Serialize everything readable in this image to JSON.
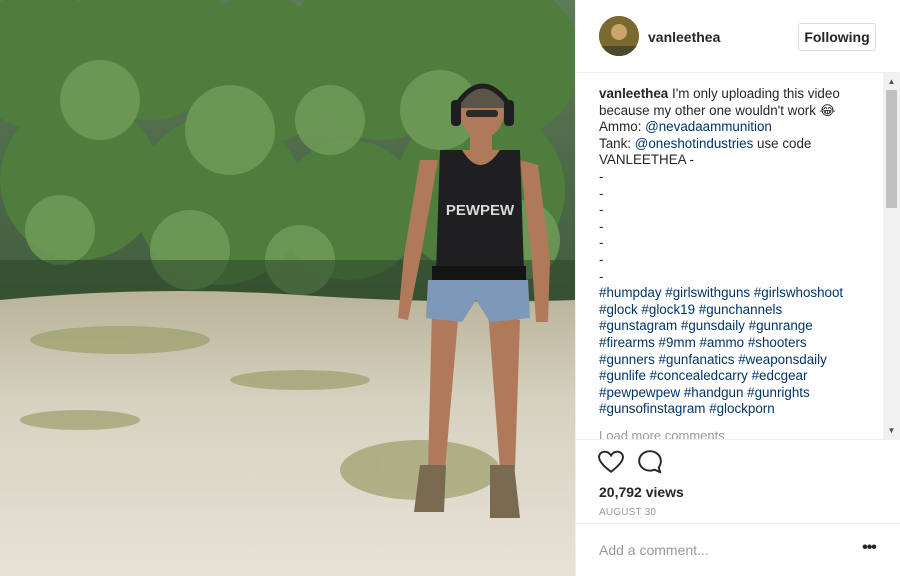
{
  "post": {
    "media_description_icon": "video-frame",
    "shirt_text": "PEWPEW"
  },
  "header": {
    "username": "vanleethea",
    "follow_button_label": "Following"
  },
  "caption": {
    "username": "vanleethea",
    "lines": [
      "I'm only uploading this video",
      "because my other one wouldn't work 😂"
    ],
    "ammo_label": "Ammo: ",
    "ammo_link": "@nevadaammunition",
    "tank_label": "Tank: ",
    "tank_link": "@oneshotindustries",
    "tank_suffix": " use code",
    "code": "VANLEETHEA -",
    "dashes": [
      "-",
      "-",
      "-",
      "-",
      "-",
      "-",
      "-"
    ],
    "hashtag_lines": [
      "#humpday #girlswithguns #girlswhoshoot",
      "#glock #glock19 #gunchannels",
      "#gunstagram #gunsdaily #gunrange",
      "#firearms #9mm #ammo #shooters",
      "#gunners #gunfanatics #weaponsdaily",
      "#gunlife #concealedcarry #edcgear",
      "#pewpewpew #handgun #gunrights",
      "#gunsofinstagram #glockporn"
    ],
    "load_more": "Load more comments"
  },
  "actions": {
    "like_icon": "heart-icon",
    "comment_icon": "comment-bubble-icon",
    "views": "20,792 views",
    "date": "AUGUST 30"
  },
  "add_comment": {
    "placeholder": "Add a comment...",
    "more_label": "•••"
  },
  "colors": {
    "link": "#003569",
    "muted": "#999999",
    "border": "#efefef",
    "text": "#262626"
  }
}
